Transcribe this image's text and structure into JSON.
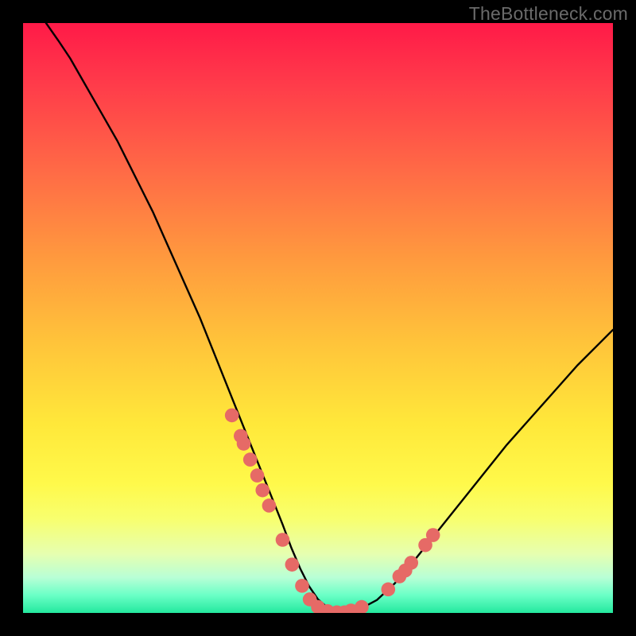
{
  "watermark": "TheBottleneck.com",
  "chart_data": {
    "type": "line",
    "title": "",
    "xlabel": "",
    "ylabel": "",
    "xlim": [
      0,
      100
    ],
    "ylim": [
      0,
      100
    ],
    "series": [
      {
        "name": "bottleneck-curve",
        "x": [
          3.9,
          6,
          8,
          10,
          12,
          14,
          16,
          18,
          20,
          22,
          24,
          26,
          28,
          30,
          32,
          34,
          36,
          38,
          40,
          42,
          44,
          45.5,
          47,
          48.5,
          50,
          51.5,
          53,
          55,
          57,
          60,
          63,
          66,
          70,
          74,
          78,
          82,
          86,
          90,
          94,
          98,
          100
        ],
        "y": [
          100,
          97,
          94,
          90.5,
          87,
          83.5,
          80,
          76,
          72,
          68,
          63.5,
          59,
          54.5,
          50,
          45,
          40,
          35,
          30,
          25,
          20,
          15,
          11,
          7.5,
          4.5,
          2.3,
          1,
          0.4,
          0.1,
          0.6,
          2.2,
          5,
          8.5,
          13.5,
          18.5,
          23.5,
          28.5,
          33,
          37.5,
          42,
          46,
          48
        ]
      }
    ],
    "markers": {
      "name": "highlighted-points",
      "color": "#e66a66",
      "points": [
        {
          "x": 35.4,
          "y": 33.5
        },
        {
          "x": 36.9,
          "y": 30.0
        },
        {
          "x": 37.4,
          "y": 28.7
        },
        {
          "x": 38.5,
          "y": 26.0
        },
        {
          "x": 39.7,
          "y": 23.3
        },
        {
          "x": 40.6,
          "y": 20.8
        },
        {
          "x": 41.7,
          "y": 18.2
        },
        {
          "x": 44.0,
          "y": 12.4
        },
        {
          "x": 45.6,
          "y": 8.2
        },
        {
          "x": 47.3,
          "y": 4.6
        },
        {
          "x": 48.6,
          "y": 2.3
        },
        {
          "x": 50.0,
          "y": 1.0
        },
        {
          "x": 51.6,
          "y": 0.3
        },
        {
          "x": 53.2,
          "y": 0.1
        },
        {
          "x": 54.5,
          "y": 0.1
        },
        {
          "x": 55.6,
          "y": 0.4
        },
        {
          "x": 57.4,
          "y": 1.0
        },
        {
          "x": 61.9,
          "y": 4.0
        },
        {
          "x": 63.8,
          "y": 6.2
        },
        {
          "x": 64.8,
          "y": 7.2
        },
        {
          "x": 65.8,
          "y": 8.5
        },
        {
          "x": 68.2,
          "y": 11.5
        },
        {
          "x": 69.5,
          "y": 13.2
        }
      ]
    }
  }
}
